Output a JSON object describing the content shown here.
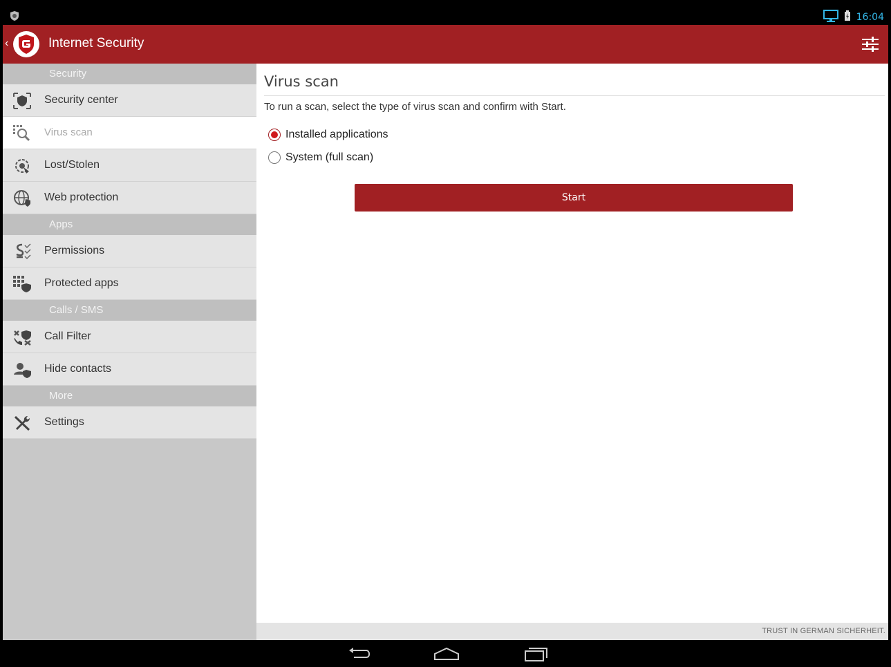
{
  "status_bar": {
    "time": "16:04",
    "icons": [
      "gdata-notification-icon",
      "monitor-icon",
      "battery-charging-icon"
    ]
  },
  "app_bar": {
    "title": "Internet Security",
    "logo": "gdata-shield-logo",
    "back_icon": "chevron-left-icon",
    "action_icon": "sliders-settings-icon",
    "color": "#a12023"
  },
  "sidebar": {
    "sections": [
      {
        "header": "Security",
        "items": [
          {
            "label": "Security center",
            "icon": "security-center-icon",
            "active": false
          },
          {
            "label": "Virus scan",
            "icon": "virus-scan-icon",
            "active": true
          },
          {
            "label": "Lost/Stolen",
            "icon": "lost-stolen-icon",
            "active": false
          },
          {
            "label": "Web protection",
            "icon": "globe-icon",
            "active": false
          }
        ]
      },
      {
        "header": "Apps",
        "items": [
          {
            "label": "Permissions",
            "icon": "permissions-icon",
            "active": false
          },
          {
            "label": "Protected apps",
            "icon": "protected-apps-icon",
            "active": false
          }
        ]
      },
      {
        "header": "Calls / SMS",
        "items": [
          {
            "label": "Call Filter",
            "icon": "call-filter-icon",
            "active": false
          },
          {
            "label": "Hide contacts",
            "icon": "hide-contacts-icon",
            "active": false
          }
        ]
      },
      {
        "header": "More",
        "items": [
          {
            "label": "Settings",
            "icon": "tools-icon",
            "active": false
          }
        ]
      }
    ]
  },
  "main": {
    "title": "Virus scan",
    "instruction": "To run a scan, select the type of virus scan and confirm with Start.",
    "options": [
      {
        "label": "Installed applications",
        "checked": true
      },
      {
        "label": "System (full scan)",
        "checked": false
      }
    ],
    "start_label": "Start"
  },
  "footer": {
    "slogan": "TRUST IN GERMAN SICHERHEIT."
  },
  "nav_bar": {
    "buttons": [
      "back-icon",
      "home-icon",
      "recent-apps-icon"
    ]
  }
}
